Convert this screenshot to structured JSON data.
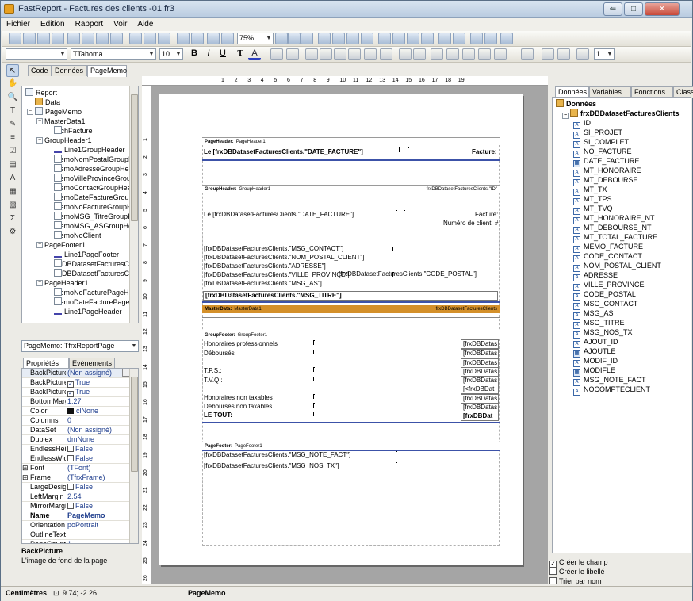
{
  "window": {
    "title": "FastReport - Factures des clients -01.fr3"
  },
  "menu": [
    "Fichier",
    "Edition",
    "Rapport",
    "Voir",
    "Aide"
  ],
  "toolbar": {
    "zoom": "75%",
    "font_name": "Tahoma",
    "font_size": "10",
    "bold": "B",
    "italic": "I",
    "underline": "U",
    "text_tool": "T",
    "text_color": "A",
    "line_width": "1"
  },
  "doc_tabs": [
    "Code",
    "Données",
    "PageMemo"
  ],
  "tree": {
    "items": [
      {
        "label": "Report",
        "level": 0,
        "icon": "report"
      },
      {
        "label": "Data",
        "level": 1,
        "icon": "db"
      },
      {
        "label": "PageMemo",
        "level": 1,
        "icon": "page"
      },
      {
        "label": "MasterData1",
        "level": 2,
        "icon": "band"
      },
      {
        "label": "RichFacture",
        "level": 3,
        "icon": "memo"
      },
      {
        "label": "GroupHeader1",
        "level": 2,
        "icon": "band"
      },
      {
        "label": "Line1GroupHeader",
        "level": 3,
        "icon": "line"
      },
      {
        "label": "MemoNomPostalGroupHe",
        "level": 3,
        "icon": "memo"
      },
      {
        "label": "MemoAdresseGroupHea",
        "level": 3,
        "icon": "memo"
      },
      {
        "label": "MemoVilleProvinceGrou",
        "level": 3,
        "icon": "memo"
      },
      {
        "label": "MemoContactGroupHea",
        "level": 3,
        "icon": "memo"
      },
      {
        "label": "MemoDateFactureGrou",
        "level": 3,
        "icon": "memo"
      },
      {
        "label": "MemoNoFactureGroupH",
        "level": 3,
        "icon": "memo"
      },
      {
        "label": "MemoMSG_TitreGroupH",
        "level": 3,
        "icon": "memo"
      },
      {
        "label": "MemoMSG_ASGroupHea",
        "level": 3,
        "icon": "memo"
      },
      {
        "label": "MemoNoClient",
        "level": 3,
        "icon": "memo"
      },
      {
        "label": "PageFooter1",
        "level": 2,
        "icon": "band"
      },
      {
        "label": "Line1PageFooter",
        "level": 3,
        "icon": "line"
      },
      {
        "label": "frxDBDatasetFacturesCl",
        "level": 3,
        "icon": "memo"
      },
      {
        "label": "frxDBDatasetFacturesCl",
        "level": 3,
        "icon": "memo"
      },
      {
        "label": "PageHeader1",
        "level": 2,
        "icon": "band"
      },
      {
        "label": "MemoNoFacturePageHe",
        "level": 3,
        "icon": "memo"
      },
      {
        "label": "MemoDateFacturePage",
        "level": 3,
        "icon": "memo"
      },
      {
        "label": "Line1PageHeader",
        "level": 3,
        "icon": "line"
      }
    ]
  },
  "inspector": {
    "object": "PageMemo: TfrxReportPage",
    "tabs": [
      "Propriétés",
      "Evènements"
    ],
    "props": [
      {
        "name": "BackPicture",
        "value": "(Non assigné)",
        "ellipsis": true
      },
      {
        "name": "BackPicturePr",
        "value": "True",
        "check": "✓"
      },
      {
        "name": "BackPictureVi",
        "value": "True",
        "check": "✓"
      },
      {
        "name": "BottomMargin",
        "value": "1.27"
      },
      {
        "name": "Color",
        "value": "clNone",
        "swatch": "#111111"
      },
      {
        "name": "Columns",
        "value": "0"
      },
      {
        "name": "DataSet",
        "value": "(Non assigné)"
      },
      {
        "name": "Duplex",
        "value": "dmNone"
      },
      {
        "name": "EndlessHeight",
        "value": "False",
        "check": ""
      },
      {
        "name": "EndlessWidth",
        "value": "False",
        "check": ""
      },
      {
        "name": "Font",
        "value": "(TFont)",
        "exp": "⊞"
      },
      {
        "name": "Frame",
        "value": "(TfrxFrame)",
        "exp": "⊞"
      },
      {
        "name": "LargeDesignH",
        "value": "False",
        "check": ""
      },
      {
        "name": "LeftMargin",
        "value": "2.54"
      },
      {
        "name": "MirrorMargins",
        "value": "False",
        "check": ""
      },
      {
        "name": "Name",
        "value": "PageMemo",
        "bold": true
      },
      {
        "name": "Orientation",
        "value": "poPortrait"
      },
      {
        "name": "OutlineText",
        "value": ""
      },
      {
        "name": "PageCount",
        "value": "1"
      }
    ],
    "desc_title": "BackPicture",
    "desc_text": "L'image de fond de la page"
  },
  "report": {
    "page_header": {
      "title": "PageHeader:",
      "name": "PageHeader1",
      "left": "Le [frxDBDatasetFacturesClients.\"DATE_FACTURE\"]",
      "right": "Facture:"
    },
    "group_header": {
      "title": "GroupHeader:",
      "name": "GroupHeader1",
      "condition": "frxDBDatasetFacturesClients.\"ID\"",
      "date": "Le [frxDBDatasetFacturesClients.\"DATE_FACTURE\"]",
      "facture": "Facture:",
      "numero": "Numéro de client: #",
      "lines": [
        "[frxDBDatasetFacturesClients.\"MSG_CONTACT\"]",
        "[frxDBDatasetFacturesClients.\"NOM_POSTAL_CLIENT\"]",
        "[frxDBDatasetFacturesClients.\"ADRESSE\"]",
        "[frxDBDatasetFacturesClients.\"VILLE_PROVINCE\"]",
        "[frxDBDatasetFacturesClients.\"MSG_AS\"]"
      ],
      "postal": "[frxDBDatasetFacturesClients.\"CODE_POSTAL\"]",
      "titre": "[frxDBDatasetFacturesClients.\"MSG_TITRE\"]"
    },
    "master_data": {
      "title": "MasterData:",
      "name": "MasterData1",
      "dataset": "frxDBDatasetFacturesClients"
    },
    "group_footer": {
      "title": "GroupFooter:",
      "name": "GroupFooter1",
      "labels": [
        "Honoraires professionnels",
        "Déboursés",
        "T.P.S.:",
        "T.V.Q.:",
        "Honoraires non taxables",
        "Déboursés non taxables",
        "LE TOUT:"
      ],
      "values": [
        "[frxDBDatas",
        "[frxDBDatas",
        "[frxDBDatas",
        "[frxDBDatas",
        "[frxDBDatas",
        "[<frxDBDat",
        "[frxDBDatas",
        "[frxDBDatas",
        "[frxDBDat"
      ]
    },
    "page_footer": {
      "title": "PageFooter:",
      "name": "PageFooter1",
      "lines": [
        "[frxDBDatasetFacturesClients.\"MSG_NOTE_FACT\"]",
        "[frxDBDatasetFacturesClients.\"MSG_NOS_TX\"]"
      ]
    }
  },
  "ruler": {
    "top": [
      "1",
      "2",
      "3",
      "4",
      "5",
      "6",
      "7",
      "8",
      "9",
      "10",
      "11",
      "12",
      "13",
      "14",
      "15",
      "16",
      "17",
      "18",
      "19"
    ],
    "left": [
      "1",
      "2",
      "3",
      "4",
      "5",
      "6",
      "7",
      "8",
      "9",
      "10",
      "11",
      "12",
      "13",
      "14",
      "15",
      "16",
      "17",
      "18",
      "19",
      "20",
      "21",
      "22",
      "23",
      "24",
      "25",
      "26"
    ]
  },
  "right_tabs": [
    "Données",
    "Variables",
    "Fonctions",
    "Classes"
  ],
  "fields": {
    "root": "Données",
    "dataset": "frxDBDatasetFacturesClients",
    "items": [
      {
        "n": "ID",
        "t": "num"
      },
      {
        "n": "SI_PROJET",
        "t": "txt"
      },
      {
        "n": "SI_COMPLET",
        "t": "txt"
      },
      {
        "n": "NO_FACTURE",
        "t": "txt"
      },
      {
        "n": "DATE_FACTURE",
        "t": "cal"
      },
      {
        "n": "MT_HONORAIRE",
        "t": "txt"
      },
      {
        "n": "MT_DEBOURSE",
        "t": "txt"
      },
      {
        "n": "MT_TX",
        "t": "txt"
      },
      {
        "n": "MT_TPS",
        "t": "txt"
      },
      {
        "n": "MT_TVQ",
        "t": "txt"
      },
      {
        "n": "MT_HONORAIRE_NT",
        "t": "txt"
      },
      {
        "n": "MT_DEBOURSE_NT",
        "t": "txt"
      },
      {
        "n": "MT_TOTAL_FACTURE",
        "t": "txt"
      },
      {
        "n": "MEMO_FACTURE",
        "t": "txt"
      },
      {
        "n": "CODE_CONTACT",
        "t": "txt"
      },
      {
        "n": "NOM_POSTAL_CLIENT",
        "t": "txt"
      },
      {
        "n": "ADRESSE",
        "t": "txt"
      },
      {
        "n": "VILLE_PROVINCE",
        "t": "txt"
      },
      {
        "n": "CODE_POSTAL",
        "t": "txt"
      },
      {
        "n": "MSG_CONTACT",
        "t": "txt"
      },
      {
        "n": "MSG_AS",
        "t": "txt"
      },
      {
        "n": "MSG_TITRE",
        "t": "txt"
      },
      {
        "n": "MSG_NOS_TX",
        "t": "txt"
      },
      {
        "n": "AJOUT_ID",
        "t": "num"
      },
      {
        "n": "AJOUTLE",
        "t": "cal"
      },
      {
        "n": "MODIF_ID",
        "t": "num"
      },
      {
        "n": "MODIFLE",
        "t": "cal"
      },
      {
        "n": "MSG_NOTE_FACT",
        "t": "txt"
      },
      {
        "n": "NOCOMPTECLIENT",
        "t": "txt"
      }
    ]
  },
  "options": [
    {
      "label": "Créer le champ",
      "checked": "✓"
    },
    {
      "label": "Créer le libellé",
      "checked": ""
    },
    {
      "label": "Trier par nom",
      "checked": ""
    }
  ],
  "status": {
    "units": "Centimètres",
    "coords": "9.74; -2.26",
    "object": "PageMemo"
  },
  "colors": {
    "masterdata_band": "#d4902a",
    "accent": "#3c52a8"
  }
}
